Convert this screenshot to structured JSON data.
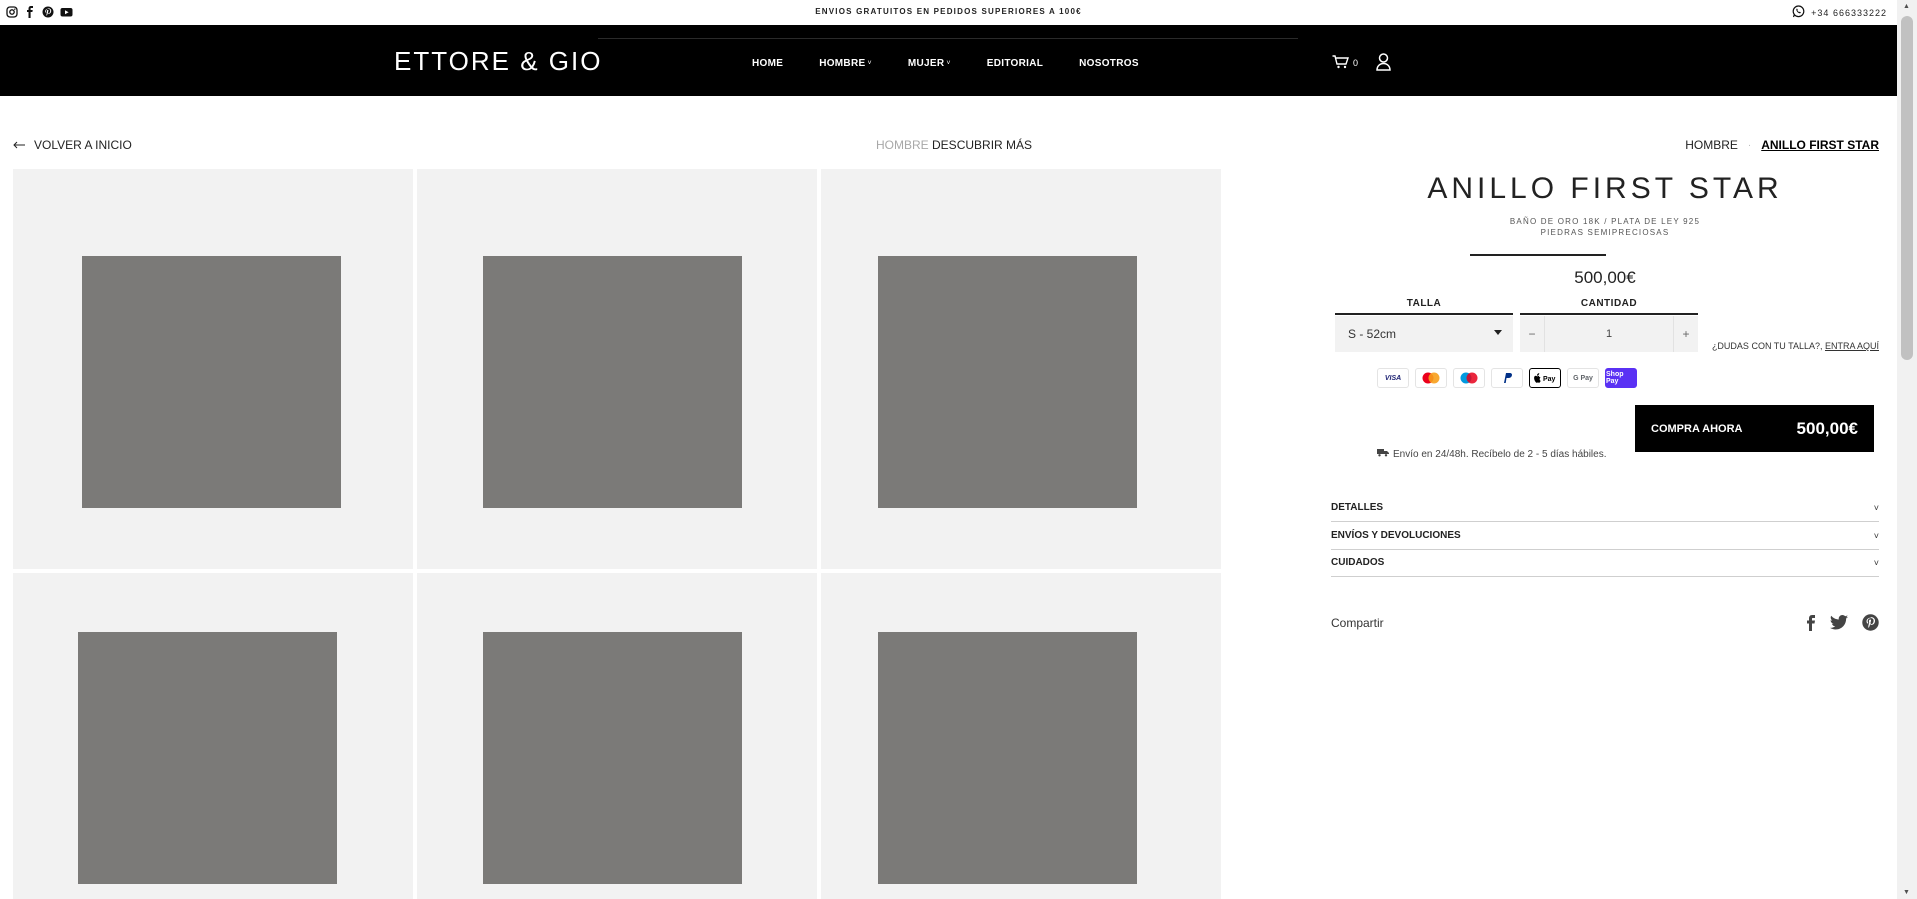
{
  "topbar": {
    "announcement": "ENVIOS GRATUITOS EN PEDIDOS SUPERIORES A 100€",
    "phone": "+34 666333222",
    "socials": [
      "instagram-icon",
      "facebook-icon",
      "pinterest-icon",
      "youtube-icon"
    ]
  },
  "header": {
    "logo": "ETTORE & GIO",
    "nav": [
      {
        "label": "HOME",
        "dropdown": false
      },
      {
        "label": "HOMBRE",
        "dropdown": true
      },
      {
        "label": "MUJER",
        "dropdown": true
      },
      {
        "label": "EDITORIAL",
        "dropdown": false
      },
      {
        "label": "NOSOTROS",
        "dropdown": false
      }
    ],
    "cart_count": "0"
  },
  "breadcrumbs": {
    "back": "VOLVER A INICIO",
    "mid_muted": "HOMBRE",
    "mid": "DESCUBRIR MÁS",
    "trail": [
      "HOMBRE",
      "ANILLO FIRST STAR"
    ]
  },
  "product": {
    "title": "ANILLO FIRST STAR",
    "subtitle_line1": "BAÑO DE ORO 18K / PLATA DE LEY 925",
    "subtitle_line2": "PIEDRAS SEMIPRECIOSAS",
    "price": "500,00€",
    "size_label": "TALLA",
    "size_value": "S - 52cm",
    "qty_label": "CANTIDAD",
    "qty_value": "1",
    "qty_minus": "−",
    "qty_plus": "+",
    "size_help": "¿DUDAS CON TU TALLA?,",
    "size_help_link": "ENTRA AQUÍ",
    "payment_methods": [
      "VISA",
      "Mastercard",
      "Maestro",
      "PayPal",
      "Apple Pay",
      "G Pay",
      "Shop Pay"
    ],
    "buy_label": "COMPRA AHORA",
    "buy_price": "500,00€",
    "shipping_note": "Envío en 24/48h. Recíbelo de 2 - 5 días hábiles.",
    "accordions": [
      "DETALLES",
      "ENVÍOS Y DEVOLUCIONES",
      "CUIDADOS"
    ],
    "share_label": "Compartir",
    "share_icons": [
      "facebook-icon",
      "twitter-icon",
      "pinterest-icon"
    ]
  },
  "gallery": {
    "tile_count": 6
  },
  "colors": {
    "header_bg": "#000000",
    "tile_bg": "#f2f2f2",
    "image_placeholder": "#7b7a78",
    "shop_pay": "#5a31f4"
  }
}
